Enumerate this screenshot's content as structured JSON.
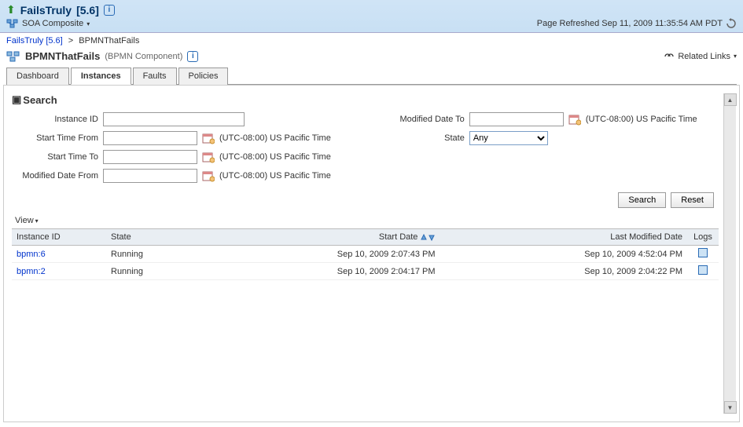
{
  "header": {
    "title": "FailsTruly",
    "version": "[5.6]",
    "soa_label": "SOA Composite",
    "refreshed": "Page Refreshed Sep 11, 2009 11:35:54 AM PDT"
  },
  "breadcrumb": {
    "item1": "FailsTruly [5.6]",
    "item2": "BPMNThatFails"
  },
  "page": {
    "title": "BPMNThatFails",
    "subtitle": "(BPMN Component)",
    "related_links": "Related Links"
  },
  "tabs": {
    "dashboard": "Dashboard",
    "instances": "Instances",
    "faults": "Faults",
    "policies": "Policies"
  },
  "search": {
    "heading": "Search",
    "instance_id_label": "Instance ID",
    "start_from_label": "Start Time From",
    "start_to_label": "Start Time To",
    "modified_from_label": "Modified Date From",
    "modified_to_label": "Modified Date To",
    "state_label": "State",
    "state_value": "Any",
    "tz": "(UTC-08:00) US Pacific Time",
    "search_btn": "Search",
    "reset_btn": "Reset"
  },
  "view_menu": "View",
  "table": {
    "headers": {
      "instance_id": "Instance ID",
      "state": "State",
      "start_date": "Start Date",
      "last_modified": "Last Modified Date",
      "logs": "Logs"
    },
    "rows": [
      {
        "id": "bpmn:6",
        "state": "Running",
        "start": "Sep 10, 2009 2:07:43 PM",
        "modified": "Sep 10, 2009 4:52:04 PM"
      },
      {
        "id": "bpmn:2",
        "state": "Running",
        "start": "Sep 10, 2009 2:04:17 PM",
        "modified": "Sep 10, 2009 2:04:22 PM"
      }
    ]
  }
}
